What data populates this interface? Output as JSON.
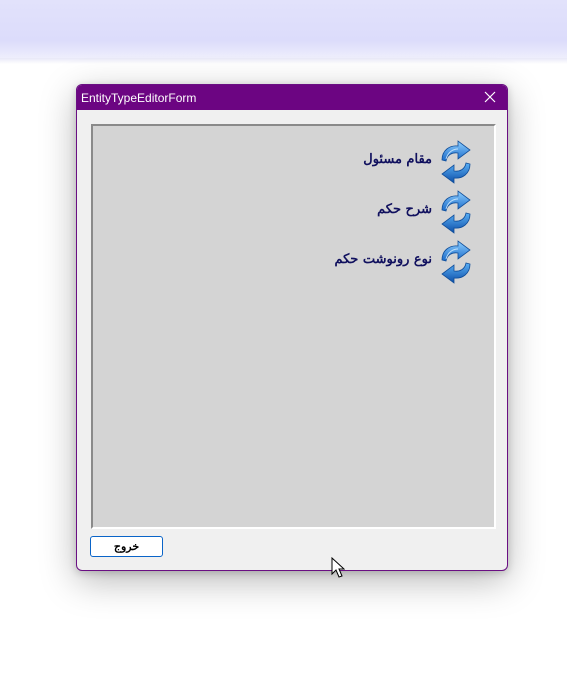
{
  "window": {
    "title": "EntityTypeEditorForm"
  },
  "items": [
    {
      "label": "مقام مسئول",
      "icon": "refresh-arrows-icon"
    },
    {
      "label": "شرح حکم",
      "icon": "refresh-arrows-icon"
    },
    {
      "label": "نوع رونوشت حکم",
      "icon": "refresh-arrows-icon"
    }
  ],
  "footer": {
    "exit_label": "خروج"
  },
  "colors": {
    "titlebar": "#6c0582",
    "panel": "#d4d4d4",
    "item_text": "#10105e",
    "button_border": "#0a64c8"
  }
}
